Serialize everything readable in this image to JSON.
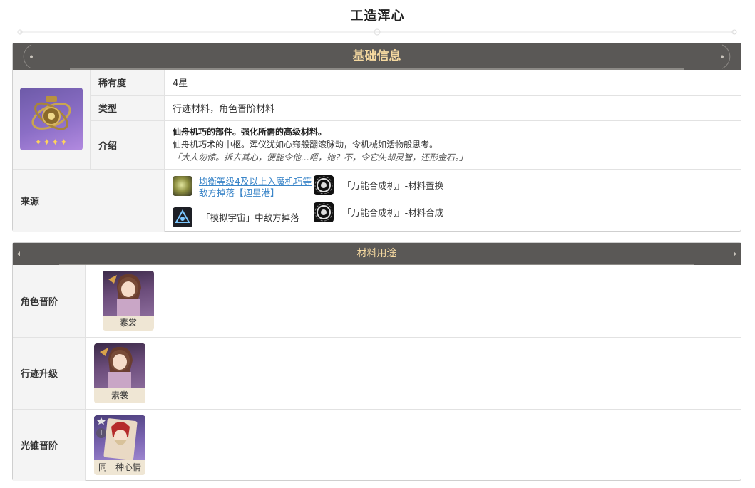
{
  "page": {
    "title": "工造浑心"
  },
  "basic": {
    "header": "基础信息",
    "stars": "✦✦✦✦",
    "rarity_label": "稀有度",
    "rarity_value": "4星",
    "type_label": "类型",
    "type_value": "行迹材料，角色晋阶材料",
    "intro_label": "介绍",
    "intro_bold": "仙舟机巧的部件。强化所需的高级材料。",
    "intro_text": "仙舟机巧术的中枢。浑仪犹如心窍般翻滚脉动，令机械如活物般思考。",
    "intro_quote": "「大人勿惊。拆去其心，便能令他…唔，她？不，令它失却灵智，还形金石。」",
    "source_label": "来源",
    "sources": [
      {
        "text_line1": "均衡等级4及以上入魔机巧等",
        "text_line2": "敌方掉落【迴星港】"
      },
      {
        "text": "「模拟宇宙」中敌方掉落"
      },
      {
        "text": "「万能合成机」-材料置换"
      },
      {
        "text": "「万能合成机」-材料合成"
      }
    ]
  },
  "usage": {
    "header": "材料用途",
    "rows": [
      {
        "label": "角色晋阶",
        "card_name": "素裳"
      },
      {
        "label": "行迹升级",
        "card_name": "素裳"
      },
      {
        "label": "光锥晋阶",
        "card_name": "同一种心情",
        "badge": "Ⅰ"
      }
    ]
  },
  "colors": {
    "header_bg": "#5a5856",
    "header_text": "#f5d9a0",
    "link": "#3a85c8",
    "item_bg": "#8b6ec6"
  }
}
